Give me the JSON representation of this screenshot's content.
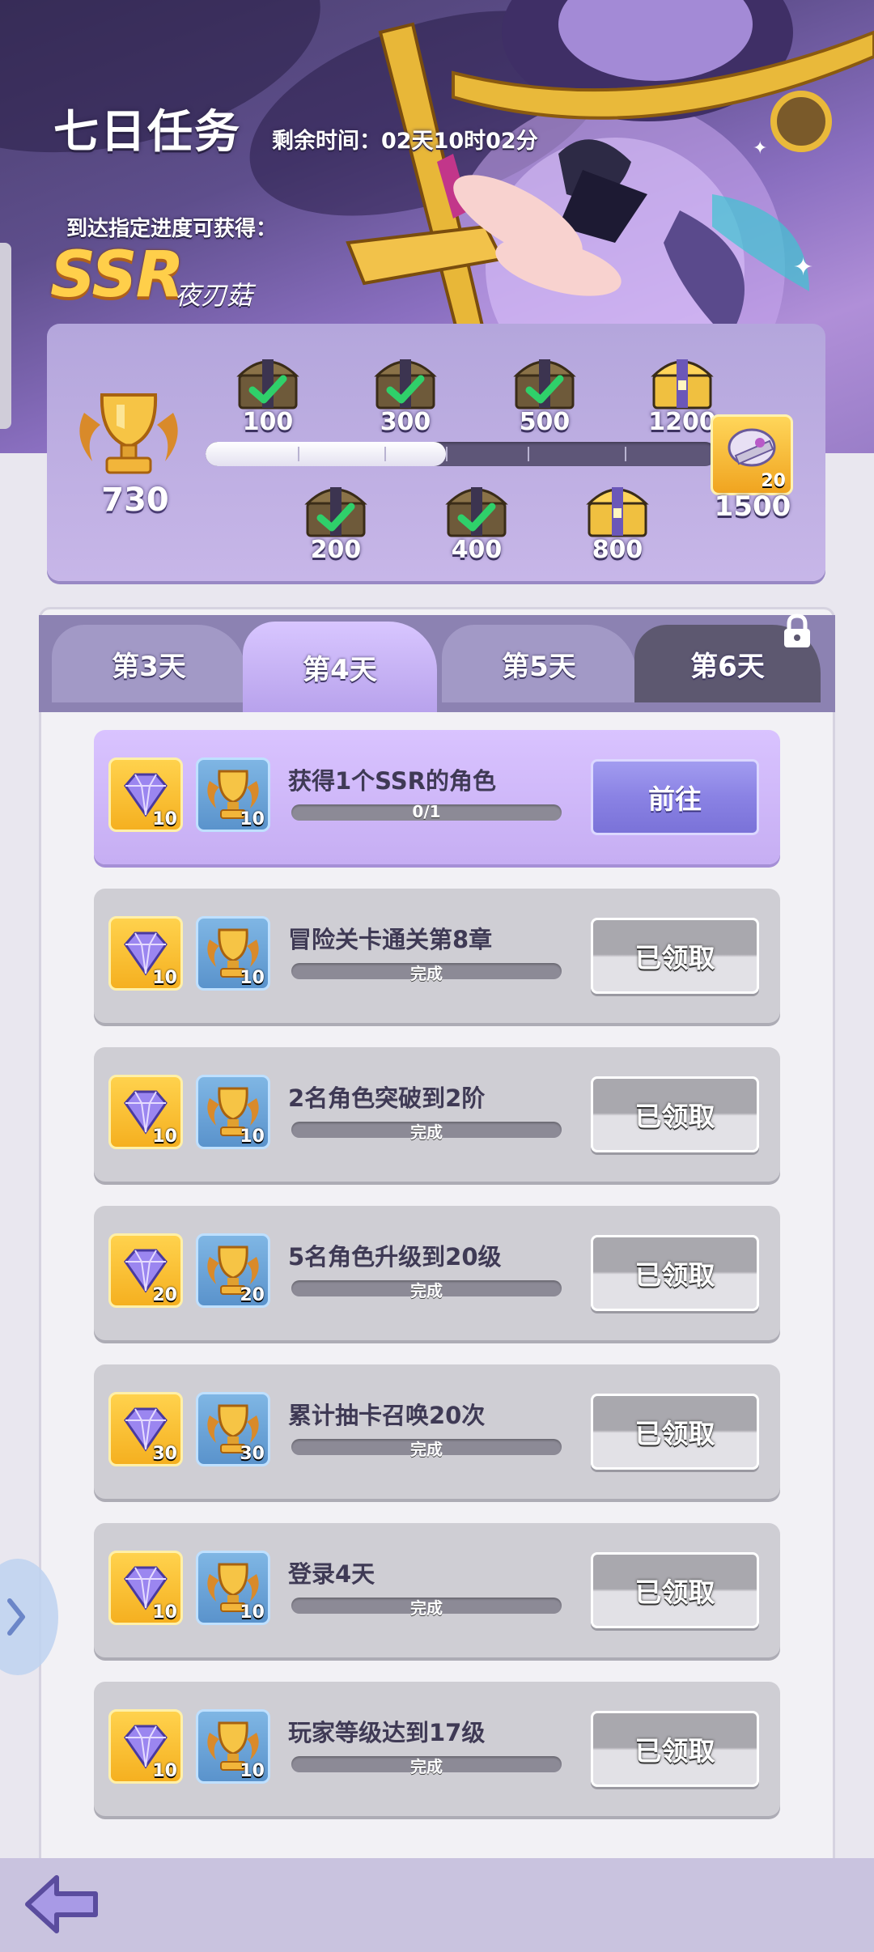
{
  "header": {
    "title": "七日任务",
    "timer_label": "剩余时间：",
    "timer_value": "02天10时02分",
    "reach_text": "到达指定进度可获得：",
    "rarity": "SSR",
    "character_name": "夜刃菇"
  },
  "progress": {
    "current_points": "730",
    "fill_fraction": 0.47,
    "milestones_top": [
      "100",
      "300",
      "500",
      "1200"
    ],
    "milestones_bottom": [
      "200",
      "400",
      "800"
    ],
    "final_milestone": "1500",
    "final_reward_qty": "20",
    "claimed_milestones": [
      "100",
      "200",
      "300",
      "400",
      "500"
    ]
  },
  "tabs": [
    {
      "label": "第3天",
      "state": "normal"
    },
    {
      "label": "第4天",
      "state": "active"
    },
    {
      "label": "第5天",
      "state": "normal"
    },
    {
      "label": "第6天",
      "state": "locked"
    }
  ],
  "tasks": [
    {
      "name": "获得1个SSR的角色",
      "progress": "0/1",
      "gem": "10",
      "trophy": "10",
      "button": "前往",
      "state": "active"
    },
    {
      "name": "冒险关卡通关第8章",
      "progress": "完成",
      "gem": "10",
      "trophy": "10",
      "button": "已领取",
      "state": "done"
    },
    {
      "name": "2名角色突破到2阶",
      "progress": "完成",
      "gem": "10",
      "trophy": "10",
      "button": "已领取",
      "state": "done"
    },
    {
      "name": "5名角色升级到20级",
      "progress": "完成",
      "gem": "20",
      "trophy": "20",
      "button": "已领取",
      "state": "done"
    },
    {
      "name": "累计抽卡召唤20次",
      "progress": "完成",
      "gem": "30",
      "trophy": "30",
      "button": "已领取",
      "state": "done"
    },
    {
      "name": "登录4天",
      "progress": "完成",
      "gem": "10",
      "trophy": "10",
      "button": "已领取",
      "state": "done"
    },
    {
      "name": "玩家等级达到17级",
      "progress": "完成",
      "gem": "10",
      "trophy": "10",
      "button": "已领取",
      "state": "done"
    }
  ],
  "icons": {
    "back": "back-arrow-icon",
    "side": "chevron-right-icon",
    "lock": "lock-icon",
    "gem": "diamond-gem-icon",
    "trophy": "trophy-icon",
    "chest": "treasure-chest-icon"
  },
  "colors": {
    "accent": "#8a82e4",
    "active_tab": "#c9b4f6",
    "gold": "#ffcf4a"
  }
}
